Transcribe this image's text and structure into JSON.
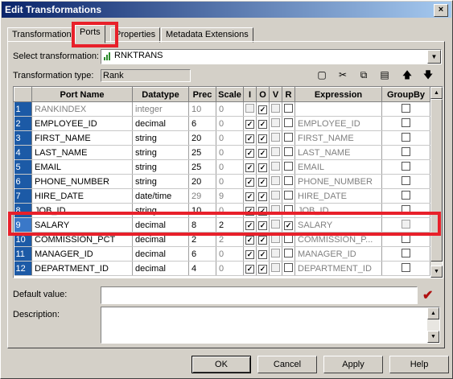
{
  "window": {
    "title": "Edit Transformations",
    "close_label": "×"
  },
  "tabs": [
    "Transformation",
    "Ports",
    "Properties",
    "Metadata Extensions"
  ],
  "select_transformation": {
    "label": "Select transformation:",
    "value": "RNKTRANS"
  },
  "transformation_type": {
    "label": "Transformation type:",
    "value": "Rank"
  },
  "toolbar": {
    "new": "▢",
    "cut": "✂",
    "copy": "⧉",
    "paste": "▤",
    "up": "🡅",
    "down": "🡇"
  },
  "columns": [
    "Port Name",
    "Datatype",
    "Prec",
    "Scale",
    "I",
    "O",
    "V",
    "R",
    "Expression",
    "GroupBy"
  ],
  "rows": [
    {
      "num": "1",
      "name": "RANKINDEX",
      "type": "integer",
      "prec": "10",
      "scale": "0",
      "i": false,
      "o": true,
      "v": false,
      "r": false,
      "expr": "",
      "gray": true
    },
    {
      "num": "2",
      "name": "EMPLOYEE_ID",
      "type": "decimal",
      "prec": "6",
      "scale": "0",
      "i": true,
      "o": true,
      "v": false,
      "r": false,
      "expr": "EMPLOYEE_ID",
      "gray": false
    },
    {
      "num": "3",
      "name": "FIRST_NAME",
      "type": "string",
      "prec": "20",
      "scale": "0",
      "i": true,
      "o": true,
      "v": false,
      "r": false,
      "expr": "FIRST_NAME",
      "gray": false
    },
    {
      "num": "4",
      "name": "LAST_NAME",
      "type": "string",
      "prec": "25",
      "scale": "0",
      "i": true,
      "o": true,
      "v": false,
      "r": false,
      "expr": "LAST_NAME",
      "gray": false
    },
    {
      "num": "5",
      "name": "EMAIL",
      "type": "string",
      "prec": "25",
      "scale": "0",
      "i": true,
      "o": true,
      "v": false,
      "r": false,
      "expr": "EMAIL",
      "gray": false
    },
    {
      "num": "6",
      "name": "PHONE_NUMBER",
      "type": "string",
      "prec": "20",
      "scale": "0",
      "i": true,
      "o": true,
      "v": false,
      "r": false,
      "expr": "PHONE_NUMBER",
      "gray": false
    },
    {
      "num": "7",
      "name": "HIRE_DATE",
      "type": "date/time",
      "prec": "29",
      "scale": "9",
      "i": true,
      "o": true,
      "v": false,
      "r": false,
      "expr": "HIRE_DATE",
      "gray": false
    },
    {
      "num": "8",
      "name": "JOB_ID",
      "type": "string",
      "prec": "10",
      "scale": "0",
      "i": true,
      "o": true,
      "v": false,
      "r": false,
      "expr": "JOB_ID",
      "gray": false
    },
    {
      "num": "9",
      "name": "SALARY",
      "type": "decimal",
      "prec": "8",
      "scale": "2",
      "i": true,
      "o": true,
      "v": false,
      "r": true,
      "expr": "SALARY",
      "gray": false
    },
    {
      "num": "10",
      "name": "COMMISSION_PCT",
      "type": "decimal",
      "prec": "2",
      "scale": "2",
      "i": true,
      "o": true,
      "v": false,
      "r": false,
      "expr": "COMMISSION_P...",
      "gray": false
    },
    {
      "num": "11",
      "name": "MANAGER_ID",
      "type": "decimal",
      "prec": "6",
      "scale": "0",
      "i": true,
      "o": true,
      "v": false,
      "r": false,
      "expr": "MANAGER_ID",
      "gray": false
    },
    {
      "num": "12",
      "name": "DEPARTMENT_ID",
      "type": "decimal",
      "prec": "4",
      "scale": "0",
      "i": true,
      "o": true,
      "v": false,
      "r": false,
      "expr": "DEPARTMENT_ID",
      "gray": false
    }
  ],
  "default_value": {
    "label": "Default value:",
    "value": ""
  },
  "description": {
    "label": "Description:",
    "value": ""
  },
  "buttons": {
    "ok": "OK",
    "cancel": "Cancel",
    "apply": "Apply",
    "help": "Help"
  }
}
